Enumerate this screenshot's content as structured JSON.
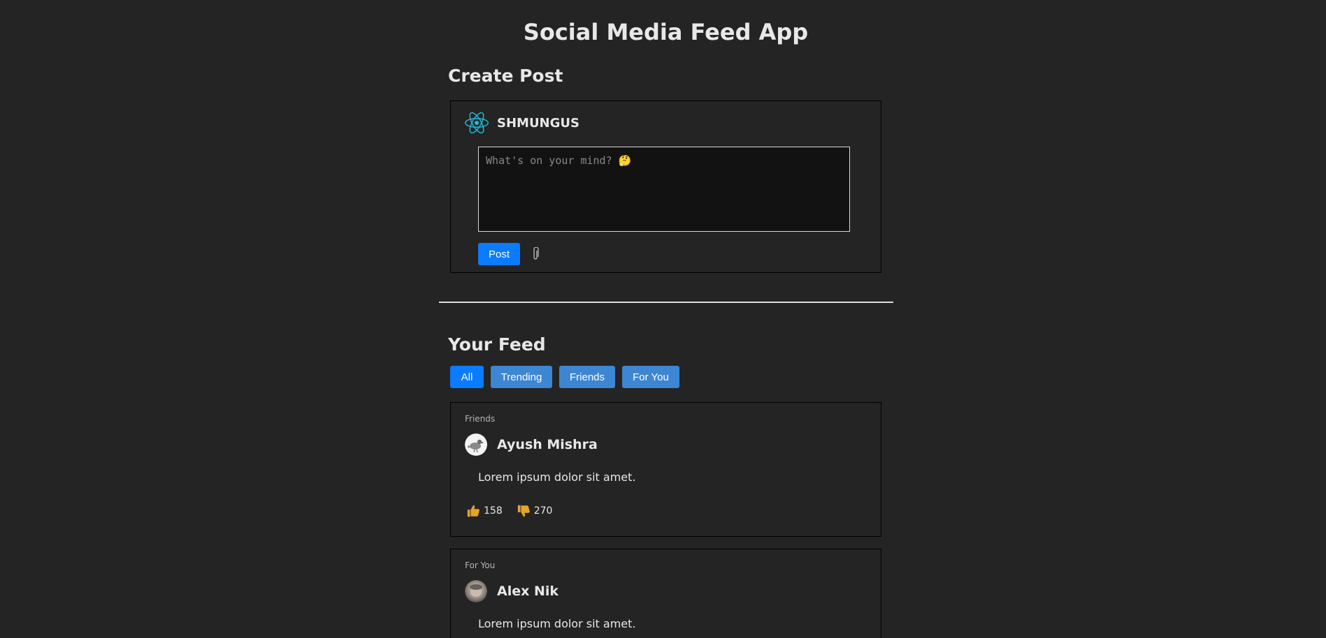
{
  "app": {
    "title": "Social Media Feed App"
  },
  "create_post": {
    "heading": "Create Post",
    "username": "SHMUNGUS",
    "placeholder": "What's on your mind? 🤔",
    "post_label": "Post",
    "attach_icon": "paperclip-icon"
  },
  "feed": {
    "heading": "Your Feed",
    "filters": [
      {
        "label": "All",
        "active": true
      },
      {
        "label": "Trending",
        "active": false
      },
      {
        "label": "Friends",
        "active": false
      },
      {
        "label": "For You",
        "active": false
      }
    ],
    "posts": [
      {
        "category": "Friends",
        "author": "Ayush Mishra",
        "avatar": "bird-avatar",
        "text": "Lorem ipsum dolor sit amet.",
        "likes": "158",
        "dislikes": "270"
      },
      {
        "category": "For You",
        "author": "Alex Nik",
        "avatar": "photo-avatar",
        "text": "Lorem ipsum dolor sit amet."
      }
    ]
  },
  "colors": {
    "background": "#242424",
    "accent": "#0b7bff",
    "filter_inactive": "#3d86d2",
    "react_logo": "#22b8d6",
    "reaction_icon": "#e3a52a"
  }
}
